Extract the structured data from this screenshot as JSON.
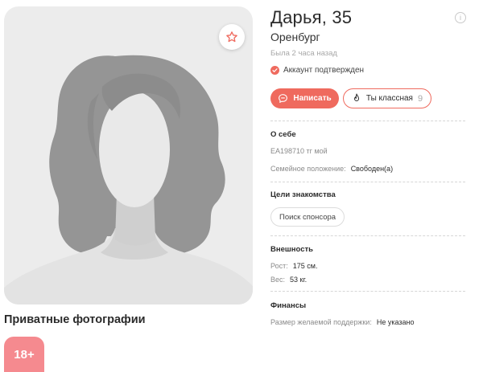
{
  "profile": {
    "name_age": "Дарья, 35",
    "city": "Оренбург",
    "last_seen": "Была 2 часа назад",
    "verified_label": "Аккаунт подтвержден"
  },
  "actions": {
    "write_label": "Написать",
    "like_label": "Ты классная",
    "like_count": "9"
  },
  "about": {
    "title": "О себе",
    "text": "EA198710 тг мой",
    "marital_label": "Семейное положение:",
    "marital_value": "Свободен(а)"
  },
  "goals": {
    "title": "Цели знакомства",
    "chips": [
      "Поиск спонсора"
    ]
  },
  "appearance": {
    "title": "Внешность",
    "height_label": "Рост:",
    "height_value": "175 см.",
    "weight_label": "Вес:",
    "weight_value": "53 кг."
  },
  "finance": {
    "title": "Финансы",
    "support_label": "Размер желаемой поддержки:",
    "support_value": "Не указано"
  },
  "private_photos": {
    "title": "Приватные фотографии",
    "badge": "18+"
  },
  "icons": {
    "favorite": "star-icon",
    "info": "info-icon",
    "verified": "check-icon",
    "write": "chat-bubble-icon",
    "like": "flame-icon"
  },
  "colors": {
    "accent": "#ef6a5e",
    "badge": "#f58a8f",
    "photo_bg": "#ececec",
    "muted_text": "#8a8a8a"
  }
}
